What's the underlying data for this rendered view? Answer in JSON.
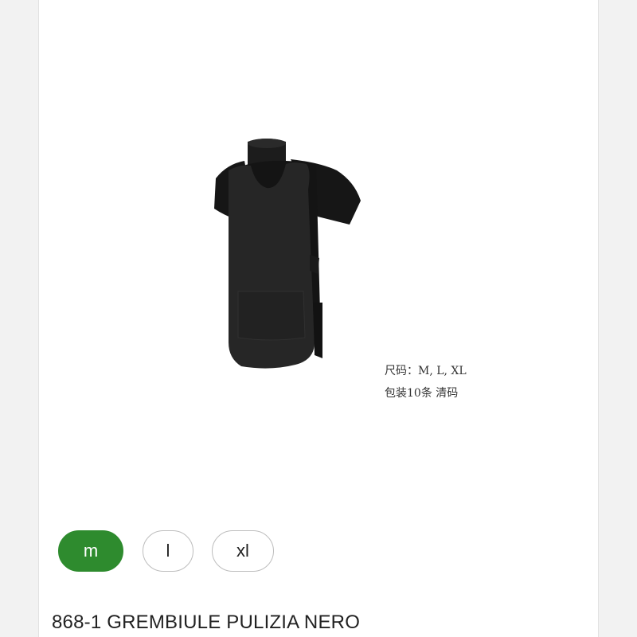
{
  "product": {
    "image_caption": {
      "line1": "尺码：M, L, XL",
      "line2": "包装10条 清码"
    },
    "garment_color": "#1f1f1f",
    "size_options": [
      {
        "label": "m",
        "selected": true
      },
      {
        "label": "l",
        "selected": false
      },
      {
        "label": "xl",
        "selected": false
      }
    ],
    "selected_color": "#2e8b2e",
    "title": "868-1 GREMBIULE PULIZIA NERO"
  }
}
